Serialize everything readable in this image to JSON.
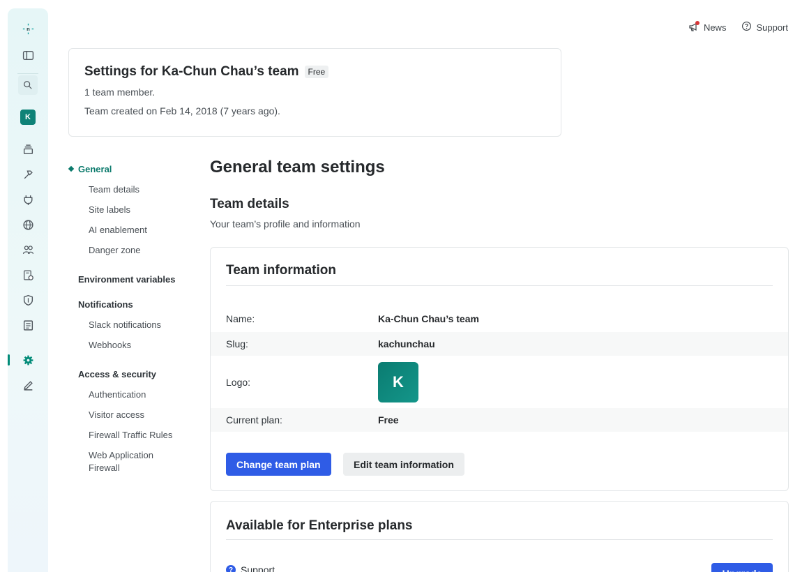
{
  "top_links": {
    "news": "News",
    "support": "Support"
  },
  "team_card": {
    "title": "Settings for Ka-Chun Chau’s team",
    "plan_badge": "Free",
    "members": "1 team member.",
    "created": "Team created on Feb 14, 2018 (7 years ago)."
  },
  "rail": {
    "avatar_letter": "K"
  },
  "nav": {
    "general": "General",
    "general_items": [
      "Team details",
      "Site labels",
      "AI enablement",
      "Danger zone"
    ],
    "env_vars": "Environment variables",
    "notifications": "Notifications",
    "notifications_items": [
      "Slack notifications",
      "Webhooks"
    ],
    "access": "Access & security",
    "access_items": [
      "Authentication",
      "Visitor access",
      "Firewall Traffic Rules",
      "Web Application Firewall"
    ]
  },
  "main": {
    "title": "General team settings",
    "section_title": "Team details",
    "section_sub": "Your team’s profile and information"
  },
  "team_info": {
    "title": "Team information",
    "name_label": "Name:",
    "name_value": "Ka-Chun Chau’s team",
    "slug_label": "Slug:",
    "slug_value": "kachunchau",
    "logo_label": "Logo:",
    "logo_letter": "K",
    "plan_label": "Current plan:",
    "plan_value": "Free",
    "change_plan_button": "Change team plan",
    "edit_button": "Edit team information"
  },
  "enterprise": {
    "title": "Available for Enterprise plans",
    "support_label": "Support",
    "upgrade_button": "Upgrade"
  },
  "colors": {
    "accent": "#0b7a6c",
    "primary_button": "#2f5ce6"
  }
}
